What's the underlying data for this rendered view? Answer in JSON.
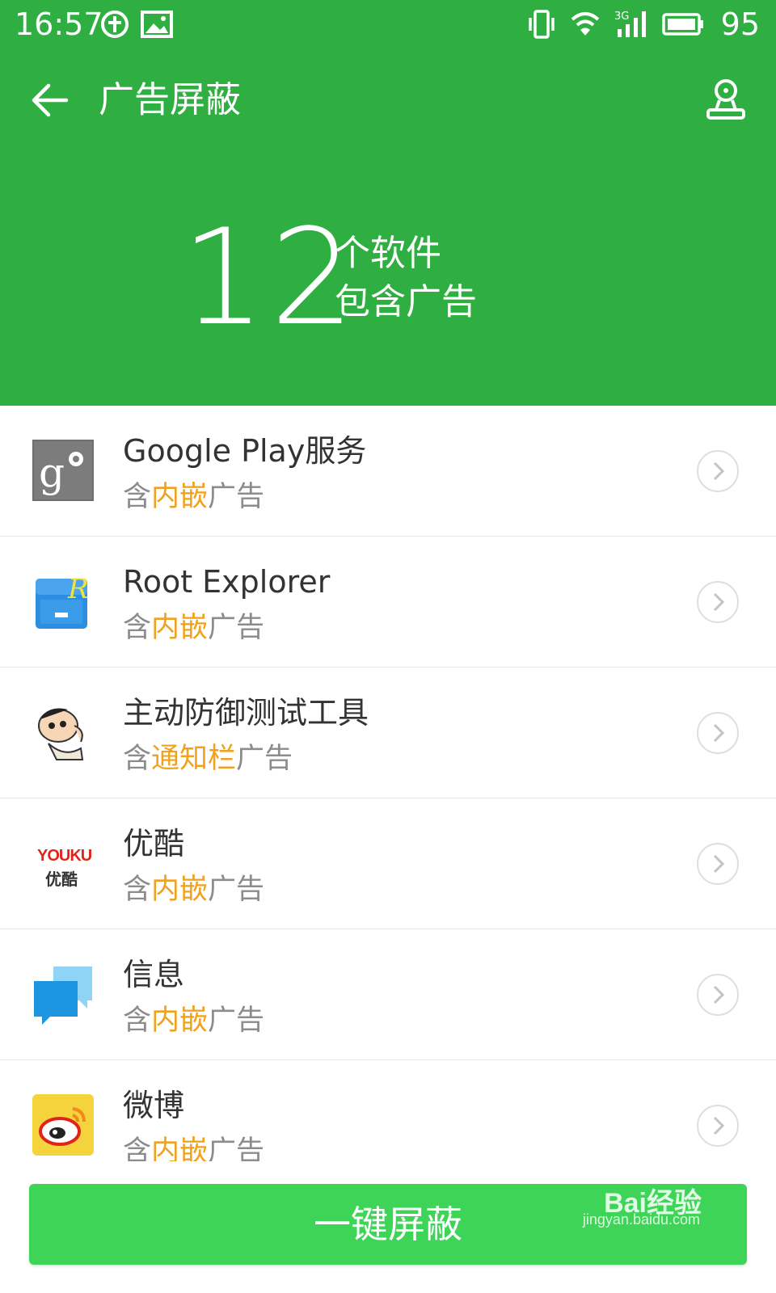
{
  "status_bar": {
    "time": "16:57",
    "battery": "95",
    "icons": [
      "sync-icon",
      "image-icon",
      "vibrate-icon",
      "wifi-icon",
      "signal-3g-icon",
      "battery-icon"
    ]
  },
  "app_bar": {
    "title": "广告屏蔽",
    "back_icon": "back-arrow-icon",
    "action_icon": "robot-icon"
  },
  "summary": {
    "count": "12",
    "line1": "个软件",
    "line2": "包含广告"
  },
  "apps": [
    {
      "name": "Google Play服务",
      "desc_prefix": "含",
      "desc_highlight": "内嵌",
      "desc_suffix": "广告",
      "icon": "google-play-services-icon"
    },
    {
      "name": "Root Explorer",
      "desc_prefix": "含",
      "desc_highlight": "内嵌",
      "desc_suffix": "广告",
      "icon": "root-explorer-icon"
    },
    {
      "name": "主动防御测试工具",
      "desc_prefix": "含",
      "desc_highlight": "通知栏",
      "desc_suffix": "广告",
      "icon": "crayon-shinchan-icon"
    },
    {
      "name": "优酷",
      "desc_prefix": "含",
      "desc_highlight": "内嵌",
      "desc_suffix": "广告",
      "icon": "youku-icon",
      "icon_text_top": "YOUKU",
      "icon_text_bottom": "优酷"
    },
    {
      "name": "信息",
      "desc_prefix": "含",
      "desc_highlight": "内嵌",
      "desc_suffix": "广告",
      "icon": "messages-icon"
    },
    {
      "name": "微博",
      "desc_prefix": "含",
      "desc_highlight": "内嵌",
      "desc_suffix": "广告",
      "icon": "weibo-icon"
    }
  ],
  "footer": {
    "button_label": "一键屏蔽",
    "watermark": "Bai经验",
    "watermark_url": "jingyan.baidu.com"
  },
  "colors": {
    "header_green": "#2fae41",
    "button_green": "#3ed458",
    "highlight_orange": "#f0a21e"
  }
}
